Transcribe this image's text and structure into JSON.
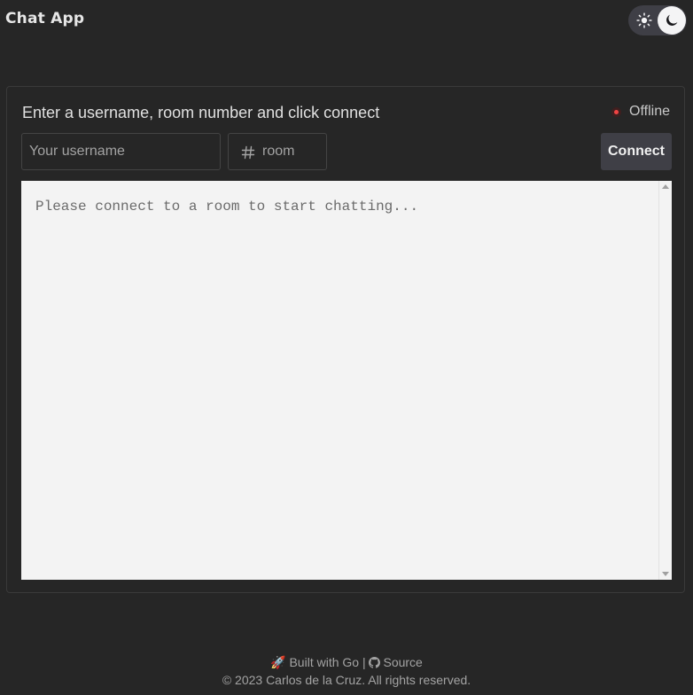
{
  "header": {
    "title": "Chat App",
    "theme_toggle": {
      "light_icon": "sun-icon",
      "dark_icon": "moon-icon",
      "mode": "dark"
    }
  },
  "chat": {
    "instruction": "Enter a username, room number and click connect",
    "status": {
      "label": "Offline",
      "color": "#ef4444"
    },
    "username": {
      "placeholder": "Your username",
      "value": ""
    },
    "room": {
      "icon": "hash-icon",
      "placeholder": "room",
      "value": ""
    },
    "connect_label": "Connect",
    "messages_placeholder": "Please connect to a room to start chatting..."
  },
  "footer": {
    "rocket": "🚀",
    "built_with": "Built with Go",
    "separator": "|",
    "source_label": "Source",
    "copyright": "© 2023 Carlos de la Cruz. All rights reserved."
  }
}
